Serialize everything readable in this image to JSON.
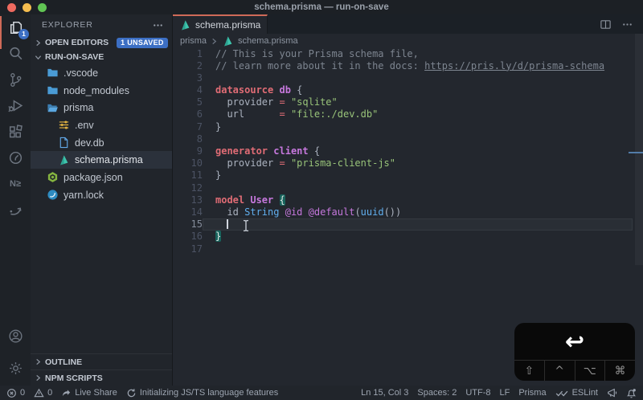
{
  "window": {
    "title": "schema.prisma — run-on-save"
  },
  "colors": {
    "accent": "#cf6a58",
    "badge_blue": "#3c6fc4",
    "prisma_teal": "#3ec5ad",
    "traffic_red": "#ee6a5f",
    "traffic_yellow": "#f5bd4f",
    "traffic_green": "#61c554",
    "bracket_match_bg": "#18635c",
    "overview_cursor": "#527ca8"
  },
  "activity_bar": {
    "items": [
      {
        "id": "explorer",
        "icon": "files-icon",
        "active": true,
        "badge": "1"
      },
      {
        "id": "search",
        "icon": "search-icon"
      },
      {
        "id": "source-control",
        "icon": "source-control-icon"
      },
      {
        "id": "run-debug",
        "icon": "run-debug-icon"
      },
      {
        "id": "extensions",
        "icon": "extensions-icon"
      },
      {
        "id": "timer",
        "icon": "clock-icon"
      },
      {
        "id": "nx-console",
        "icon": "nx-icon"
      },
      {
        "id": "redo-tool",
        "icon": "swoosh-icon"
      }
    ],
    "bottom": [
      {
        "id": "account",
        "icon": "account-icon"
      },
      {
        "id": "settings",
        "icon": "gear-icon"
      }
    ]
  },
  "sidebar": {
    "header": "EXPLORER",
    "open_editors": {
      "label": "OPEN EDITORS",
      "badge": "1 UNSAVED"
    },
    "root_label": "RUN-ON-SAVE",
    "files": [
      {
        "label": ".vscode",
        "icon": "folder-icon",
        "indent": 0
      },
      {
        "label": "node_modules",
        "icon": "folder-icon",
        "indent": 0
      },
      {
        "label": "prisma",
        "icon": "folder-open-icon",
        "indent": 0
      },
      {
        "label": ".env",
        "icon": "env-icon",
        "indent": 1
      },
      {
        "label": "dev.db",
        "icon": "db-file-icon",
        "indent": 1
      },
      {
        "label": "schema.prisma",
        "icon": "prisma-icon",
        "indent": 1,
        "selected": true
      },
      {
        "label": "package.json",
        "icon": "node-icon",
        "indent": 0
      },
      {
        "label": "yarn.lock",
        "icon": "yarn-icon",
        "indent": 0
      }
    ],
    "sections": [
      {
        "label": "OUTLINE"
      },
      {
        "label": "NPM SCRIPTS"
      }
    ]
  },
  "editor": {
    "tab": {
      "label": "schema.prisma",
      "dirty": true
    },
    "breadcrumb": {
      "folder": "prisma",
      "file": "schema.prisma"
    },
    "code": {
      "cursor": {
        "line": 15,
        "col": 3
      },
      "syntax_colors": {
        "comment": "#7d8590",
        "keyword": "#e06c75",
        "entity": "#c678dd",
        "default": "#abb2bf",
        "operator": "#e06c75",
        "string": "#98c379",
        "type": "#61afef",
        "attribute": "#c678dd",
        "function": "#61afef"
      },
      "lines": [
        {
          "n": 1,
          "tokens": [
            [
              "cm",
              "// This is your Prisma schema file,"
            ]
          ]
        },
        {
          "n": 2,
          "tokens": [
            [
              "cm",
              "// learn more about it in the docs: "
            ],
            [
              "cm-link",
              "https://pris.ly/d/prisma-schema"
            ]
          ]
        },
        {
          "n": 3,
          "tokens": []
        },
        {
          "n": 4,
          "tokens": [
            [
              "kw",
              "datasource"
            ],
            [
              "fg",
              " "
            ],
            [
              "ent",
              "db"
            ],
            [
              "fg",
              " {"
            ]
          ]
        },
        {
          "n": 5,
          "tokens": [
            [
              "fg",
              "  provider "
            ],
            [
              "op",
              "="
            ],
            [
              "fg",
              " "
            ],
            [
              "str",
              "\"sqlite\""
            ]
          ]
        },
        {
          "n": 6,
          "tokens": [
            [
              "fg",
              "  url      "
            ],
            [
              "op",
              "="
            ],
            [
              "fg",
              " "
            ],
            [
              "str",
              "\"file:./dev.db\""
            ]
          ]
        },
        {
          "n": 7,
          "tokens": [
            [
              "fg",
              "}"
            ]
          ]
        },
        {
          "n": 8,
          "tokens": []
        },
        {
          "n": 9,
          "tokens": [
            [
              "kw",
              "generator"
            ],
            [
              "fg",
              " "
            ],
            [
              "ent",
              "client"
            ],
            [
              "fg",
              " {"
            ]
          ]
        },
        {
          "n": 10,
          "tokens": [
            [
              "fg",
              "  provider "
            ],
            [
              "op",
              "="
            ],
            [
              "fg",
              " "
            ],
            [
              "str",
              "\"prisma-client-js\""
            ]
          ]
        },
        {
          "n": 11,
          "tokens": [
            [
              "fg",
              "}"
            ]
          ]
        },
        {
          "n": 12,
          "tokens": []
        },
        {
          "n": 13,
          "tokens": [
            [
              "kw",
              "model"
            ],
            [
              "fg",
              " "
            ],
            [
              "ent",
              "User"
            ],
            [
              "fg",
              " "
            ],
            [
              "fg-bh",
              "{"
            ]
          ]
        },
        {
          "n": 14,
          "tokens": [
            [
              "fg",
              "  id "
            ],
            [
              "typ",
              "String"
            ],
            [
              "fg",
              " "
            ],
            [
              "attr",
              "@id"
            ],
            [
              "fg",
              " "
            ],
            [
              "attr",
              "@default"
            ],
            [
              "fg",
              "("
            ],
            [
              "fn",
              "uuid"
            ],
            [
              "fg",
              "())"
            ]
          ]
        },
        {
          "n": 15,
          "tokens": [
            [
              "fg",
              "  "
            ]
          ],
          "cursor": true,
          "current": true
        },
        {
          "n": 16,
          "tokens": [
            [
              "fg-bh",
              "}"
            ]
          ]
        },
        {
          "n": 17,
          "tokens": []
        }
      ]
    }
  },
  "status_bar": {
    "left": [
      {
        "id": "errors",
        "icon": "error-icon",
        "label": "0"
      },
      {
        "id": "warnings",
        "icon": "warning-icon",
        "label": "0"
      },
      {
        "id": "live-share",
        "icon": "live-share-icon",
        "label": "Live Share"
      },
      {
        "id": "init-status",
        "icon": "sync-icon",
        "label": "Initializing JS/TS language features"
      }
    ],
    "right": [
      {
        "id": "cursor-position",
        "label": "Ln 15, Col 3"
      },
      {
        "id": "indentation",
        "label": "Spaces: 2"
      },
      {
        "id": "encoding",
        "label": "UTF-8"
      },
      {
        "id": "eol",
        "label": "LF"
      },
      {
        "id": "language-mode",
        "label": "Prisma"
      },
      {
        "id": "eslint",
        "icon": "eslint-check-icon",
        "label": "ESLint"
      },
      {
        "id": "feedback",
        "icon": "feedback-icon",
        "label": ""
      },
      {
        "id": "notifications",
        "icon": "bell-icon",
        "label": ""
      }
    ]
  },
  "keystroke_overlay": {
    "key": {
      "id": "return",
      "symbol": "↩"
    },
    "modifiers": [
      {
        "id": "shift",
        "symbol": "⇧"
      },
      {
        "id": "control",
        "symbol": "^"
      },
      {
        "id": "option",
        "symbol": "⌥"
      },
      {
        "id": "command",
        "symbol": "⌘"
      }
    ]
  }
}
